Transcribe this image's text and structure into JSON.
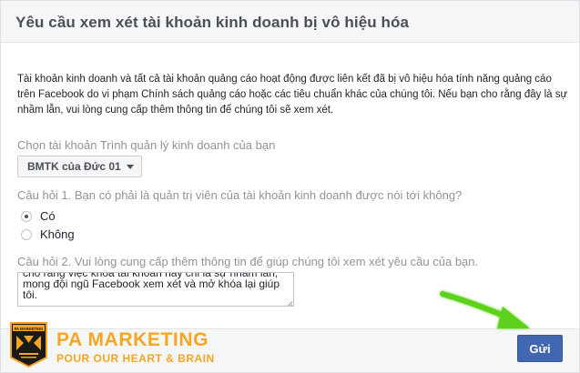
{
  "dialog": {
    "title": "Yêu cầu xem xét tài khoản kinh doanh bị vô hiệu hóa",
    "intro": "Tài khoản kinh doanh và tất cả tài khoản quảng cáo hoạt động được liên kết đã bị vô hiệu hóa tính năng quảng cáo trên Facebook do vi phạm Chính sách quảng cáo hoặc các tiêu chuẩn khác của chúng tôi. Nếu bạn cho rằng đây là sự nhầm lẫn, vui lòng cung cấp thêm thông tin để chúng tôi sẽ xem xét."
  },
  "account": {
    "label": "Chọn tài khoản Trình quản lý kinh doanh của bạn",
    "selected": "BMTK của Đức 01"
  },
  "question1": {
    "label": "Câu hỏi 1. Bạn có phải là quản trị viên của tài khoản kinh doanh được nói tới không?",
    "options": [
      {
        "label": "Có",
        "checked": true
      },
      {
        "label": "Không",
        "checked": false
      }
    ]
  },
  "question2": {
    "label": "Câu hỏi 2. Vui lòng cung cấp thêm thông tin để giúp chúng tôi xem xét yêu cầu của bạn.",
    "value": "cho rằng việc khóa tài khoản này chỉ là sự nhầm lẫn, mong đội ngũ Facebook xem xét và mở khóa lại giúp tôi."
  },
  "footer": {
    "submit_label": "Gửi",
    "brand_name": "PA MARKETING",
    "brand_slogan": "POUR OUR HEART & BRAIN",
    "logo_text": "PA MARKETING",
    "logo_icon": "pa-marketing-logo",
    "arrow_icon": "green-arrow-icon"
  },
  "colors": {
    "brand_orange": "#f5a623",
    "facebook_blue": "#4267b2",
    "arrow_green": "#5bd21e"
  }
}
